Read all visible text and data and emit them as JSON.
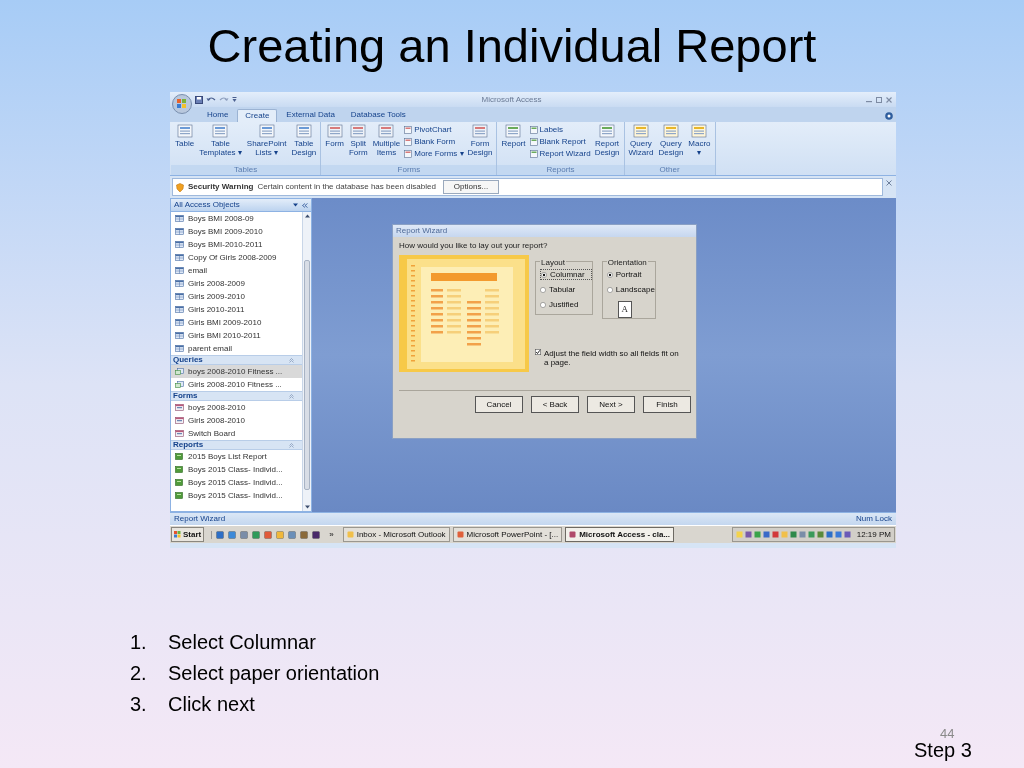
{
  "slide": {
    "title": "Creating an Individual Report",
    "page_number": "44",
    "footer": "Step 3",
    "steps": [
      {
        "number": "1.",
        "text": "Select Columnar"
      },
      {
        "number": "2.",
        "text": "Select paper orientation"
      },
      {
        "number": "3.",
        "text": "Click next"
      }
    ]
  },
  "app": {
    "window_title": "Microsoft Access",
    "tabs": [
      {
        "label": "Home",
        "selected": false
      },
      {
        "label": "Create",
        "selected": true
      },
      {
        "label": "External Data",
        "selected": false
      },
      {
        "label": "Database Tools",
        "selected": false
      }
    ],
    "ribbon_groups": [
      {
        "label": "Tables",
        "controls": [
          {
            "kind": "large",
            "label": "Table"
          },
          {
            "kind": "large",
            "label": "Table\nTemplates ▾"
          },
          {
            "kind": "large",
            "label": "SharePoint\nLists ▾"
          },
          {
            "kind": "large",
            "label": "Table\nDesign"
          }
        ]
      },
      {
        "label": "Forms",
        "controls": [
          {
            "kind": "large",
            "label": "Form"
          },
          {
            "kind": "large",
            "label": "Split\nForm"
          },
          {
            "kind": "large",
            "label": "Multiple\nItems"
          },
          {
            "kind": "small",
            "items": [
              "PivotChart",
              "Blank Form",
              "More Forms ▾"
            ]
          },
          {
            "kind": "large",
            "label": "Form\nDesign"
          }
        ]
      },
      {
        "label": "Reports",
        "controls": [
          {
            "kind": "large",
            "label": "Report"
          },
          {
            "kind": "small",
            "items": [
              "Labels",
              "Blank Report",
              "Report Wizard"
            ]
          },
          {
            "kind": "large",
            "label": "Report\nDesign"
          }
        ]
      },
      {
        "label": "Other",
        "controls": [
          {
            "kind": "large",
            "label": "Query\nWizard"
          },
          {
            "kind": "large",
            "label": "Query\nDesign"
          },
          {
            "kind": "large",
            "label": "Macro\n▾"
          }
        ]
      }
    ],
    "security_bar": {
      "title": "Security Warning",
      "message": "Certain content in the database has been disabled",
      "button": "Options..."
    },
    "nav": {
      "header": "All Access Objects",
      "groups": [
        {
          "kind": "table",
          "items": [
            {
              "label": "Boys BMI 2008-09",
              "selected": false
            },
            {
              "label": "Boys BMI 2009-2010",
              "selected": false
            },
            {
              "label": "Boys BMI-2010-2011",
              "selected": false
            },
            {
              "label": "Copy Of Girls 2008-2009",
              "selected": false
            },
            {
              "label": "email",
              "selected": false
            },
            {
              "label": "Girls 2008-2009",
              "selected": false
            },
            {
              "label": "Girls 2009-2010",
              "selected": false
            },
            {
              "label": "Girls 2010-2011",
              "selected": false
            },
            {
              "label": "Girls BMI 2009-2010",
              "selected": false
            },
            {
              "label": "Girls BMI 2010-2011",
              "selected": false
            },
            {
              "label": "parent email",
              "selected": false
            }
          ]
        },
        {
          "kind": "query",
          "label": "Queries",
          "items": [
            {
              "label": "boys 2008-2010 Fitness ...",
              "selected": true
            },
            {
              "label": "Girls 2008-2010 Fitness ...",
              "selected": false
            }
          ]
        },
        {
          "kind": "form",
          "label": "Forms",
          "items": [
            {
              "label": "boys 2008-2010",
              "selected": false
            },
            {
              "label": "Girls 2008-2010",
              "selected": false
            },
            {
              "label": "Switch Board",
              "selected": false
            }
          ]
        },
        {
          "kind": "report",
          "label": "Reports",
          "items": [
            {
              "label": "2015 Boys List Report",
              "selected": false
            },
            {
              "label": "Boys 2015 Class- Individ...",
              "selected": false
            },
            {
              "label": "Boys 2015 Class- Individ...",
              "selected": false
            },
            {
              "label": "Boys 2015 Class- Individ...",
              "selected": false
            }
          ]
        }
      ]
    },
    "dialog": {
      "title": "Report Wizard",
      "question": "How would you like to lay out your report?",
      "layout": {
        "label": "Layout",
        "options": [
          {
            "label": "Columnar",
            "selected": true
          },
          {
            "label": "Tabular",
            "selected": false
          },
          {
            "label": "Justified",
            "selected": false
          }
        ]
      },
      "orientation": {
        "label": "Orientation",
        "options": [
          {
            "label": "Portrait",
            "selected": true
          },
          {
            "label": "Landscape",
            "selected": false
          }
        ],
        "page_letter": "A"
      },
      "checkbox": {
        "label": "Adjust the field width so all fields fit on a page.",
        "checked": true
      },
      "buttons": [
        "Cancel",
        "< Back",
        "Next >",
        "Finish"
      ]
    },
    "status_bar": {
      "left": "Report Wizard",
      "right": "Num Lock"
    },
    "taskbar": {
      "start": "Start",
      "overflow": "»",
      "tasks": [
        {
          "label": "Inbox - Microsoft Outlook",
          "selected": false
        },
        {
          "label": "Microsoft PowerPoint - [...",
          "selected": false
        },
        {
          "label": "Microsoft Access - cla...",
          "selected": true
        }
      ],
      "clock": "12:19 PM"
    }
  }
}
